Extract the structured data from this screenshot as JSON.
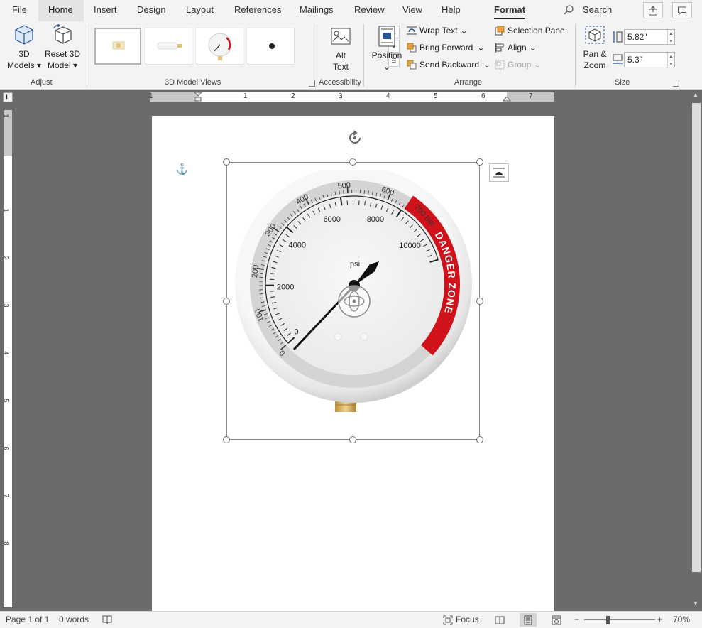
{
  "tabs": {
    "file": "File",
    "home": "Home",
    "insert": "Insert",
    "design": "Design",
    "layout": "Layout",
    "references": "References",
    "mailings": "Mailings",
    "review": "Review",
    "view": "View",
    "help": "Help",
    "format": "Format",
    "search": "Search"
  },
  "ribbon": {
    "adjust": {
      "label": "Adjust",
      "models_line1": "3D",
      "models_line2": "Models",
      "reset_line1": "Reset 3D",
      "reset_line2": "Model"
    },
    "views": {
      "label": "3D Model Views"
    },
    "accessibility": {
      "label": "Accessibility",
      "alt_line1": "Alt",
      "alt_line2": "Text"
    },
    "arrange": {
      "label": "Arrange",
      "position": "Position",
      "wrap_text": "Wrap Text",
      "bring_forward": "Bring Forward",
      "send_backward": "Send Backward",
      "selection_pane": "Selection Pane",
      "align": "Align",
      "group": "Group"
    },
    "size": {
      "label": "Size",
      "pan_line1": "Pan &",
      "pan_line2": "Zoom",
      "height": "5.82\"",
      "width": "5.3\""
    }
  },
  "ruler": {
    "h_numbers": [
      "1",
      "1",
      "2",
      "3",
      "4",
      "5",
      "6",
      "7"
    ],
    "v_numbers": [
      "1",
      "1",
      "2",
      "3",
      "4",
      "5",
      "6",
      "7",
      "8"
    ],
    "corner": "L"
  },
  "gauge": {
    "bar_labels": [
      "0",
      "100",
      "200",
      "300",
      "400",
      "500",
      "600",
      "700 bar"
    ],
    "psi_labels": [
      "0",
      "2000",
      "4000",
      "6000",
      "8000",
      "10000"
    ],
    "unit": "psi",
    "danger_text": "DANGER ZONE"
  },
  "status": {
    "page": "Page 1 of 1",
    "words": "0 words",
    "focus": "Focus",
    "zoom": "70%"
  },
  "colors": {
    "danger_red": "#d0121b",
    "accent": "#2b579a"
  }
}
